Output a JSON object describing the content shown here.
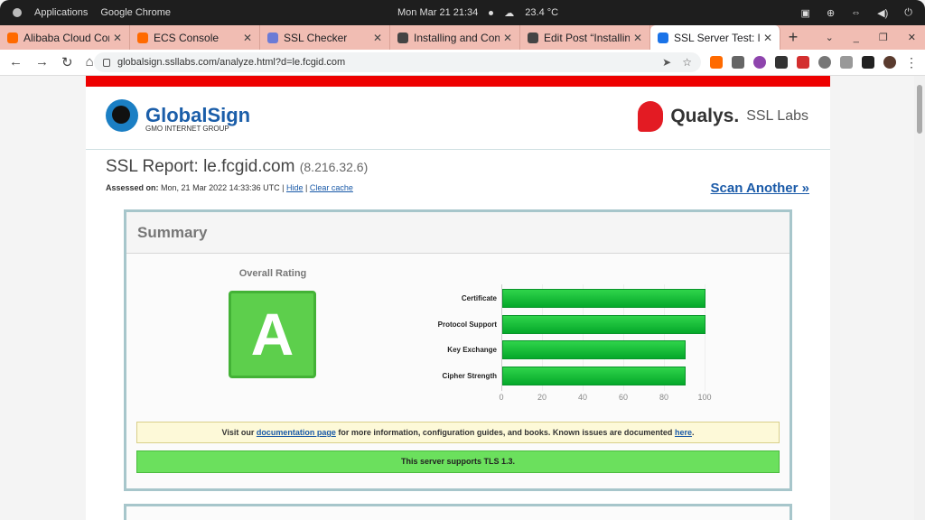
{
  "os": {
    "activities": "Applications",
    "app": "Google Chrome",
    "datetime": "Mon Mar 21  21:34",
    "weather": "23.4 °C"
  },
  "tabs": [
    {
      "label": "Alibaba Cloud Con",
      "color": "#ff6a00"
    },
    {
      "label": "ECS Console",
      "color": "#ff6a00"
    },
    {
      "label": "SSL Checker",
      "color": "#6b7bd6"
    },
    {
      "label": "Installing and Con",
      "color": "#444444"
    },
    {
      "label": "Edit Post “Installin",
      "color": "#444444"
    },
    {
      "label": "SSL Server Test: le.",
      "color": "#1a73e8",
      "active": true
    }
  ],
  "toolbar": {
    "url": "globalsign.ssllabs.com/analyze.html?d=le.fcgid.com"
  },
  "header": {
    "globalsign": "GlobalSign",
    "globalsign_sub": "GMO INTERNET GROUP",
    "qualys": "Qualys.",
    "ssllabs": "SSL Labs"
  },
  "report": {
    "title": "SSL Report: le.fcgid.com",
    "ip": "(8.216.32.6)",
    "assessed_label": "Assessed on:",
    "assessed_value": "Mon, 21 Mar 2022 14:33:36 UTC |",
    "hide": "Hide",
    "clear_cache": "Clear cache",
    "scan_another": "Scan Another »"
  },
  "summary": {
    "title": "Summary",
    "overall_label": "Overall Rating",
    "grade": "A",
    "notice_pre": "Visit our",
    "notice_link": "documentation page",
    "notice_mid": "for more information, configuration guides, and books. Known issues are documented",
    "notice_here": "here",
    "notice_end": ".",
    "tls_note": "This server supports TLS 1.3."
  },
  "chart_data": {
    "type": "bar",
    "orientation": "horizontal",
    "categories": [
      "Certificate",
      "Protocol Support",
      "Key Exchange",
      "Cipher Strength"
    ],
    "values": [
      100,
      100,
      90,
      90
    ],
    "xlim": [
      0,
      100
    ],
    "ticks": [
      "0",
      "20",
      "40",
      "60",
      "80",
      "100"
    ],
    "bar_color": "#1ec53f"
  }
}
